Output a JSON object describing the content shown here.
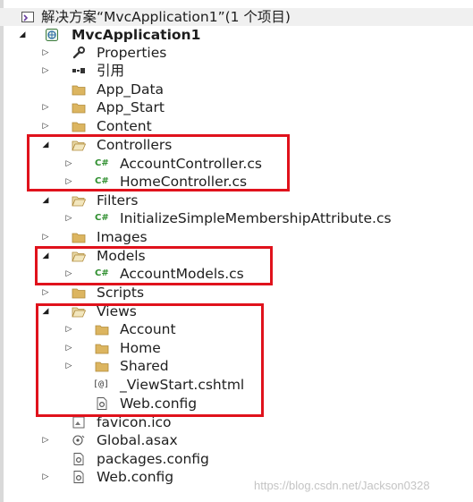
{
  "solution": {
    "label": "解决方案“MvcApplication1”(1 个项目)"
  },
  "project": {
    "label": "MvcApplication1"
  },
  "items": {
    "properties": "Properties",
    "references": "引用",
    "app_data": "App_Data",
    "app_start": "App_Start",
    "content": "Content",
    "controllers": "Controllers",
    "account_controller": "AccountController.cs",
    "home_controller": "HomeController.cs",
    "filters": "Filters",
    "initialize_attr": "InitializeSimpleMembershipAttribute.cs",
    "images": "Images",
    "models": "Models",
    "account_models": "AccountModels.cs",
    "scripts": "Scripts",
    "views": "Views",
    "views_account": "Account",
    "views_home": "Home",
    "views_shared": "Shared",
    "viewstart": "_ViewStart.cshtml",
    "views_webconfig": "Web.config",
    "favicon": "favicon.ico",
    "global": "Global.asax",
    "packages": "packages.config",
    "webconfig": "Web.config"
  },
  "icons": {
    "csharp_glyph": "C#",
    "razor_glyph": "[@]"
  },
  "watermark": "https://blog.csdn.net/Jackson0328",
  "colors": {
    "highlight": "#e0121c",
    "folder": "#d9b25a",
    "csharp": "#2f8f2f"
  }
}
